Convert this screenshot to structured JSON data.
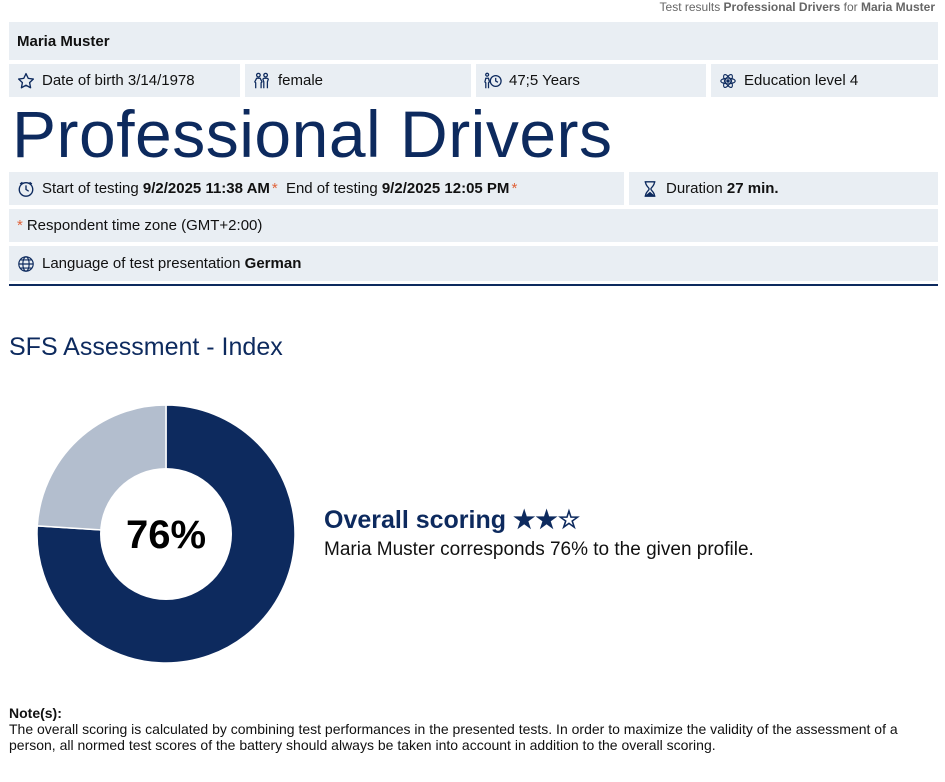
{
  "header": {
    "prefix": "Test results",
    "test_name": "Professional Drivers",
    "for_word": "for",
    "person": "Maria Muster"
  },
  "person": {
    "name": "Maria Muster",
    "dob_label": "Date of birth",
    "dob": "3/14/1978",
    "gender": "female",
    "age": "47;5 Years",
    "education": "Education level 4"
  },
  "test": {
    "title": "Professional Drivers",
    "start_label": "Start of testing",
    "start": "9/2/2025 11:38 AM",
    "end_label": "End of testing",
    "end": "9/2/2025 12:05 PM",
    "duration_label": "Duration",
    "duration": "27 min.",
    "asterisk": "*",
    "timezone": "Respondent time zone (GMT+2:00)",
    "language_label": "Language of test presentation",
    "language": "German"
  },
  "section": {
    "title": "SFS Assessment - Index"
  },
  "chart_data": {
    "type": "pie",
    "labels": [
      "",
      ""
    ],
    "values": [
      76,
      24
    ],
    "colors": [
      "#0d2a5e",
      "#b3bece"
    ],
    "center_label": "76%"
  },
  "score": {
    "title": "Overall scoring",
    "stars": "★★☆",
    "text": "Maria Muster corresponds 76% to the given profile."
  },
  "note": {
    "heading": "Note(s):",
    "text": "The overall scoring is calculated by combining test performances in the presented tests. In order to maximize the validity of the assessment of a person, all normed test scores of the battery should always be taken into account in addition to the overall scoring."
  },
  "icons": {
    "dob": "star-icon",
    "gender": "person-pair-icon",
    "age": "age-clock-icon",
    "education": "atom-icon",
    "start": "clock-icon",
    "duration": "hourglass-icon",
    "language": "globe-icon"
  }
}
